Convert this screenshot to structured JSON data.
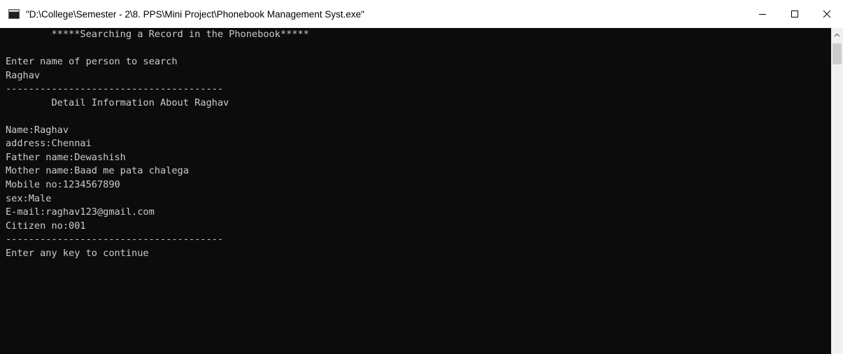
{
  "window": {
    "title": "\"D:\\College\\Semester - 2\\8. PPS\\Mini Project\\Phonebook Management Syst.exe\""
  },
  "console": {
    "lines": [
      "        *****Searching a Record in the Phonebook*****",
      "",
      "Enter name of person to search",
      "Raghav",
      "--------------------------------------",
      "        Detail Information About Raghav",
      "",
      "Name:Raghav",
      "address:Chennai",
      "Father name:Dewashish",
      "Mother name:Baad me pata chalega",
      "Mobile no:1234567890",
      "sex:Male",
      "E-mail:raghav123@gmail.com",
      "Citizen no:001",
      "--------------------------------------",
      "Enter any key to continue"
    ]
  },
  "icons": {
    "app": "console-app-icon",
    "minimize": "minimize-icon",
    "maximize": "maximize-icon",
    "close": "close-icon",
    "scroll_up": "scroll-up-arrow-icon"
  },
  "colors": {
    "console_bg": "#0c0c0c",
    "console_text": "#cccccc",
    "titlebar_bg": "#ffffff",
    "scrollbar_track": "#f0f0f0",
    "scrollbar_thumb": "#cdcdcd"
  }
}
